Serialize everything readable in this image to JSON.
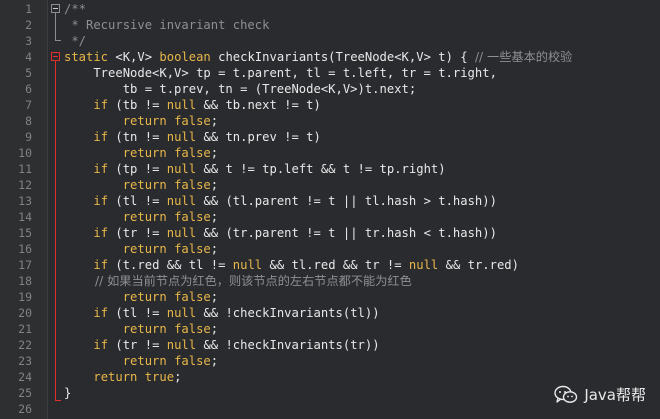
{
  "colors": {
    "background": "#292b2e",
    "gutter": "#2d2f31",
    "keyword": "#e8b64a",
    "comment": "#8d8f93",
    "plain": "#e8e8e8",
    "fold_marker": "#e0302a"
  },
  "line_numbers": [
    "1",
    "2",
    "3",
    "4",
    "5",
    "6",
    "7",
    "8",
    "9",
    "10",
    "11",
    "12",
    "13",
    "14",
    "15",
    "16",
    "17",
    "18",
    "19",
    "20",
    "21",
    "22",
    "23",
    "24",
    "25",
    "26"
  ],
  "code": [
    [
      {
        "t": "/**",
        "c": "cm"
      }
    ],
    [
      {
        "t": " * Recursive invariant check",
        "c": "cm"
      }
    ],
    [
      {
        "t": " */",
        "c": "cm"
      }
    ],
    [
      {
        "t": "static",
        "c": "kw"
      },
      {
        "t": " <K,V> ",
        "c": "pl"
      },
      {
        "t": "boolean",
        "c": "kw"
      },
      {
        "t": " checkInvariants(TreeNode<K,V> t) { ",
        "c": "pl"
      },
      {
        "t": "// 一些基本的校验",
        "c": "cm"
      }
    ],
    [
      {
        "t": "    TreeNode<K,V> tp = t.parent, tl = t.left, tr = t.right,",
        "c": "pl"
      }
    ],
    [
      {
        "t": "        tb = t.prev, tn = (TreeNode<K,V>)t.next;",
        "c": "pl"
      }
    ],
    [
      {
        "t": "    ",
        "c": "pl"
      },
      {
        "t": "if",
        "c": "kw"
      },
      {
        "t": " (tb != ",
        "c": "pl"
      },
      {
        "t": "null",
        "c": "kw"
      },
      {
        "t": " && tb.next != t)",
        "c": "pl"
      }
    ],
    [
      {
        "t": "        ",
        "c": "pl"
      },
      {
        "t": "return false",
        "c": "kw"
      },
      {
        "t": ";",
        "c": "pl"
      }
    ],
    [
      {
        "t": "    ",
        "c": "pl"
      },
      {
        "t": "if",
        "c": "kw"
      },
      {
        "t": " (tn != ",
        "c": "pl"
      },
      {
        "t": "null",
        "c": "kw"
      },
      {
        "t": " && tn.prev != t)",
        "c": "pl"
      }
    ],
    [
      {
        "t": "        ",
        "c": "pl"
      },
      {
        "t": "return false",
        "c": "kw"
      },
      {
        "t": ";",
        "c": "pl"
      }
    ],
    [
      {
        "t": "    ",
        "c": "pl"
      },
      {
        "t": "if",
        "c": "kw"
      },
      {
        "t": " (tp != ",
        "c": "pl"
      },
      {
        "t": "null",
        "c": "kw"
      },
      {
        "t": " && t != tp.left && t != tp.right)",
        "c": "pl"
      }
    ],
    [
      {
        "t": "        ",
        "c": "pl"
      },
      {
        "t": "return false",
        "c": "kw"
      },
      {
        "t": ";",
        "c": "pl"
      }
    ],
    [
      {
        "t": "    ",
        "c": "pl"
      },
      {
        "t": "if",
        "c": "kw"
      },
      {
        "t": " (tl != ",
        "c": "pl"
      },
      {
        "t": "null",
        "c": "kw"
      },
      {
        "t": " && (tl.parent != t || tl.hash > t.hash))",
        "c": "pl"
      }
    ],
    [
      {
        "t": "        ",
        "c": "pl"
      },
      {
        "t": "return false",
        "c": "kw"
      },
      {
        "t": ";",
        "c": "pl"
      }
    ],
    [
      {
        "t": "    ",
        "c": "pl"
      },
      {
        "t": "if",
        "c": "kw"
      },
      {
        "t": " (tr != ",
        "c": "pl"
      },
      {
        "t": "null",
        "c": "kw"
      },
      {
        "t": " && (tr.parent != t || tr.hash < t.hash))",
        "c": "pl"
      }
    ],
    [
      {
        "t": "        ",
        "c": "pl"
      },
      {
        "t": "return false",
        "c": "kw"
      },
      {
        "t": ";",
        "c": "pl"
      }
    ],
    [
      {
        "t": "    ",
        "c": "pl"
      },
      {
        "t": "if",
        "c": "kw"
      },
      {
        "t": " (t.red && tl != ",
        "c": "pl"
      },
      {
        "t": "null",
        "c": "kw"
      },
      {
        "t": " && tl.red && tr != ",
        "c": "pl"
      },
      {
        "t": "null",
        "c": "kw"
      },
      {
        "t": " && tr.red)",
        "c": "pl"
      }
    ],
    [
      {
        "t": "        // 如果当前节点为红色，则该节点的左右节点都不能为红色",
        "c": "cm"
      }
    ],
    [
      {
        "t": "        ",
        "c": "pl"
      },
      {
        "t": "return false",
        "c": "kw"
      },
      {
        "t": ";",
        "c": "pl"
      }
    ],
    [
      {
        "t": "    ",
        "c": "pl"
      },
      {
        "t": "if",
        "c": "kw"
      },
      {
        "t": " (tl != ",
        "c": "pl"
      },
      {
        "t": "null",
        "c": "kw"
      },
      {
        "t": " && !checkInvariants(tl))",
        "c": "pl"
      }
    ],
    [
      {
        "t": "        ",
        "c": "pl"
      },
      {
        "t": "return false",
        "c": "kw"
      },
      {
        "t": ";",
        "c": "pl"
      }
    ],
    [
      {
        "t": "    ",
        "c": "pl"
      },
      {
        "t": "if",
        "c": "kw"
      },
      {
        "t": " (tr != ",
        "c": "pl"
      },
      {
        "t": "null",
        "c": "kw"
      },
      {
        "t": " && !checkInvariants(tr))",
        "c": "pl"
      }
    ],
    [
      {
        "t": "        ",
        "c": "pl"
      },
      {
        "t": "return false",
        "c": "kw"
      },
      {
        "t": ";",
        "c": "pl"
      }
    ],
    [
      {
        "t": "    ",
        "c": "pl"
      },
      {
        "t": "return true",
        "c": "kw"
      },
      {
        "t": ";",
        "c": "pl"
      }
    ],
    [
      {
        "t": "}",
        "c": "pl"
      }
    ],
    []
  ],
  "watermark": {
    "icon": "wechat-icon",
    "text": "Java帮帮"
  }
}
